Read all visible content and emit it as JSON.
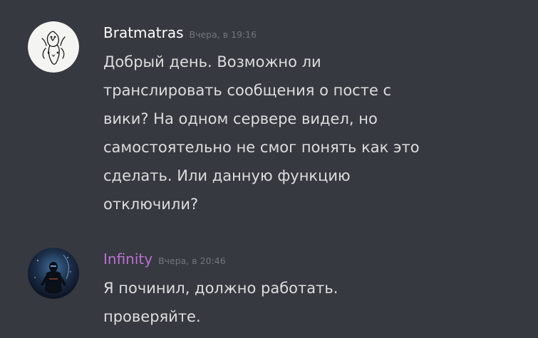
{
  "messages": [
    {
      "author": "Bratmatras",
      "timestamp": "Вчера, в 19:16",
      "lines": [
        "Добрый день. Возможно ли",
        "транслировать сообщения о посте с",
        "вики? На одном сервере видел, но",
        "самостоятельно не смог понять как это",
        "сделать. Или данную функцию",
        "отключили?"
      ]
    },
    {
      "author": "Infinity",
      "timestamp": "Вчера, в 20:46",
      "lines": [
        "Я починил, должно работать.",
        "проверяйте."
      ]
    }
  ],
  "colors": {
    "background": "#36393f",
    "username_default": "#ffffff",
    "username_infinity": "#b971d4",
    "timestamp": "#72767d",
    "message_text": "#dcddde"
  },
  "icons": {
    "avatar1": "sketch-creature-avatar",
    "avatar2": "space-figure-avatar"
  }
}
